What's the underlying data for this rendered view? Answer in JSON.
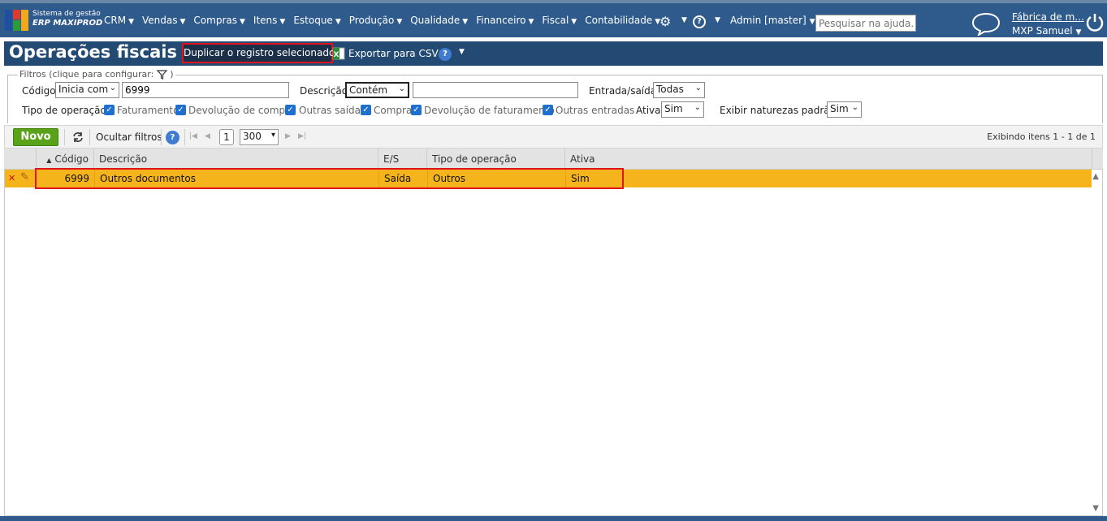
{
  "brand": {
    "line1": "Sistema de gestão",
    "line2": "ERP MAXIPROD"
  },
  "menu": [
    "CRM",
    "Vendas",
    "Compras",
    "Itens",
    "Estoque",
    "Produção",
    "Qualidade",
    "Financeiro",
    "Fiscal",
    "Contabilidade"
  ],
  "help_symbol": "?",
  "admin_label": "Admin [master]",
  "search_placeholder": "Pesquisar na ajuda...",
  "company": "Fábrica de m...",
  "user": "MXP Samuel",
  "page_title": "Operações fiscais",
  "actions": {
    "duplicate": "Duplicar o registro selecionado",
    "export_csv": "Exportar para CSV"
  },
  "filters": {
    "legend": "Filtros (clique para configurar:",
    "legend_close": ")",
    "codigo_label": "Código",
    "codigo_mode": "Inicia com",
    "codigo_value": "6999",
    "descricao_label": "Descrição",
    "descricao_mode": "Contém",
    "descricao_value": "",
    "entrada_saida_label": "Entrada/saída",
    "entrada_saida_value": "Todas",
    "tipo_label": "Tipo de operação",
    "tipos": [
      "Faturamento",
      "Devolução de compra",
      "Outras saídas",
      "Compra",
      "Devolução de faturamento",
      "Outras entradas"
    ],
    "ativa_label": "Ativa",
    "ativa_value": "Sim",
    "exibir_label": "Exibir naturezas padrão",
    "exibir_value": "Sim"
  },
  "toolbar": {
    "novo": "Novo",
    "ocultar": "Ocultar filtros",
    "page": "1",
    "page_size": "300",
    "showing": "Exibindo itens 1 - 1 de 1"
  },
  "table": {
    "columns": [
      "Código",
      "Descrição",
      "E/S",
      "Tipo de operação",
      "Ativa"
    ],
    "rows": [
      {
        "codigo": "6999",
        "descricao": "Outros documentos",
        "es": "Saída",
        "tipo": "Outros",
        "ativa": "Sim"
      }
    ]
  },
  "colors": {
    "nav": "#2f5a8c",
    "title_bar": "#234a72",
    "selected_row": "#f5b41c",
    "highlight": "#e0141e",
    "novo": "#58a318"
  }
}
